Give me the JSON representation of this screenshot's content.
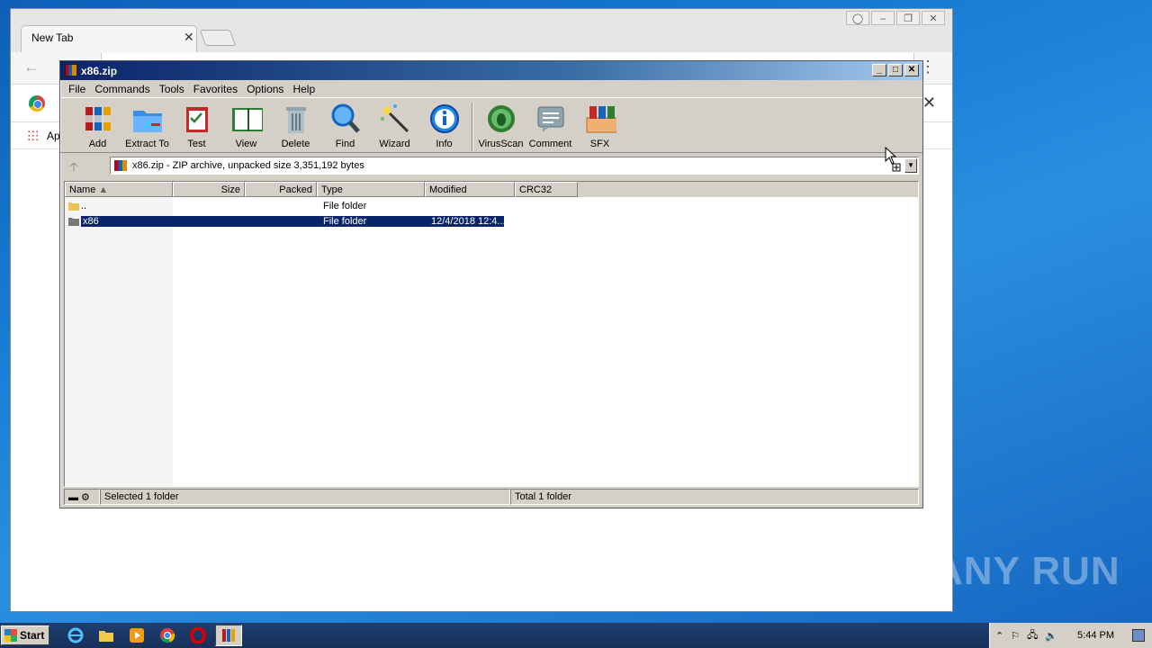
{
  "chrome": {
    "tab_title": "New Tab",
    "tab_close": "✕",
    "bookmarks_apps_label": "Ap"
  },
  "winrar": {
    "title": "x86.zip",
    "menu": [
      "File",
      "Commands",
      "Tools",
      "Favorites",
      "Options",
      "Help"
    ],
    "toolbar": [
      {
        "label": "Add",
        "icon": "add-archive-icon"
      },
      {
        "label": "Extract To",
        "icon": "extract-folder-icon"
      },
      {
        "label": "Test",
        "icon": "test-clipboard-icon"
      },
      {
        "label": "View",
        "icon": "view-book-icon"
      },
      {
        "label": "Delete",
        "icon": "trash-can-icon"
      },
      {
        "label": "Find",
        "icon": "magnifier-icon"
      },
      {
        "label": "Wizard",
        "icon": "magic-wand-icon"
      },
      {
        "label": "Info",
        "icon": "info-icon"
      },
      {
        "label": "VirusScan",
        "icon": "virus-bug-icon"
      },
      {
        "label": "Comment",
        "icon": "comment-icon"
      },
      {
        "label": "SFX",
        "icon": "sfx-box-icon"
      }
    ],
    "address": "x86.zip - ZIP archive, unpacked size 3,351,192 bytes",
    "columns": [
      "Name",
      "Size",
      "Packed",
      "Type",
      "Modified",
      "CRC32"
    ],
    "rows": [
      {
        "name": "..",
        "size": "",
        "packed": "",
        "type": "File folder",
        "modified": "",
        "crc": "",
        "selected": false
      },
      {
        "name": "x86",
        "size": "",
        "packed": "",
        "type": "File folder",
        "modified": "12/4/2018 12:4...",
        "crc": "",
        "selected": true
      }
    ],
    "status_left": "Selected 1 folder",
    "status_right": "Total 1 folder"
  },
  "taskbar": {
    "start_label": "Start",
    "clock": "5:44 PM",
    "tasks": [
      "ie-icon",
      "explorer-folder-icon",
      "media-player-icon",
      "chrome-icon",
      "opera-icon",
      "winrar-icon"
    ]
  },
  "watermark": "ANY RUN",
  "colors": {
    "selection": "#0a246a",
    "titlebar_start": "#0a246a",
    "titlebar_end": "#a6caf0",
    "window_face": "#d4d0c8"
  }
}
